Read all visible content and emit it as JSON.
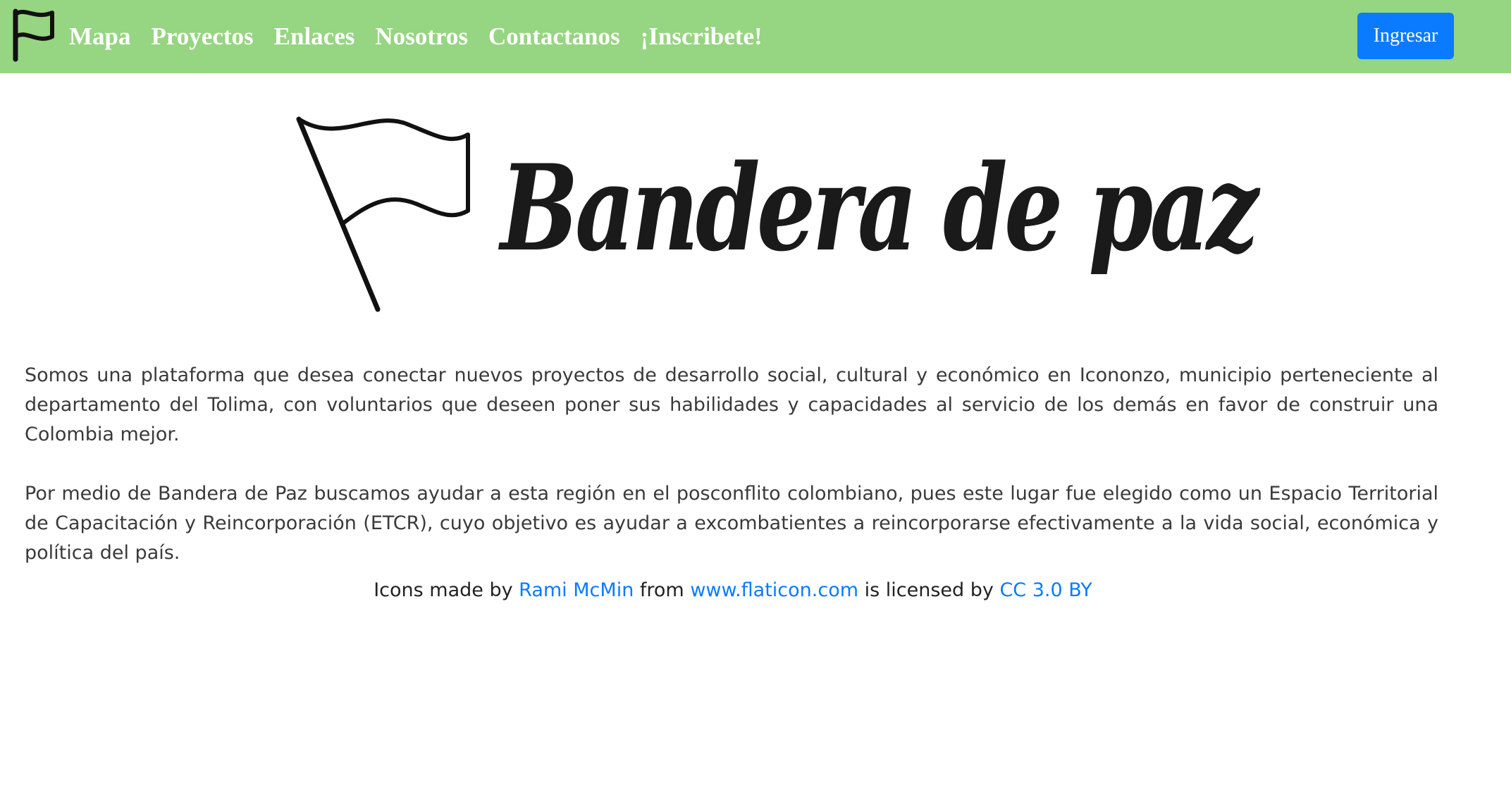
{
  "colors": {
    "navbar_bg": "#96d581",
    "nav_text": "#ffffff",
    "primary_button": "#0a7bff",
    "link": "#0a7bff"
  },
  "navbar": {
    "logo_icon": "flag-icon",
    "links": [
      "Mapa",
      "Proyectos",
      "Enlaces",
      "Nosotros",
      "Contactanos",
      "¡Inscribete!"
    ],
    "login_label": "Ingresar"
  },
  "hero": {
    "logo_icon": "flag-icon",
    "title": "Bandera de paz"
  },
  "about": {
    "paragraph_1": "Somos una plataforma que desea conectar nuevos proyectos de desarrollo social, cultural y económico en Icononzo, municipio perteneciente al departamento del Tolima, con voluntarios que deseen poner sus habilidades y capacidades al servicio de los demás en favor de construir una Colombia mejor.",
    "paragraph_2": "Por medio de Bandera de Paz buscamos ayudar a esta región en el posconflito colombiano, pues este lugar fue elegido como un Espacio Territorial de Capacitación y Reincorporación (ETCR), cuyo objetivo es ayudar a excombatientes a reincorporarse efectivamente a la vida social, económica y política del país."
  },
  "credits": {
    "prefix": "Icons made by ",
    "author": "Rami McMin",
    "middle": " from ",
    "site": "www.flaticon.com",
    "licensed": " is licensed by ",
    "license": "CC 3.0 BY"
  }
}
